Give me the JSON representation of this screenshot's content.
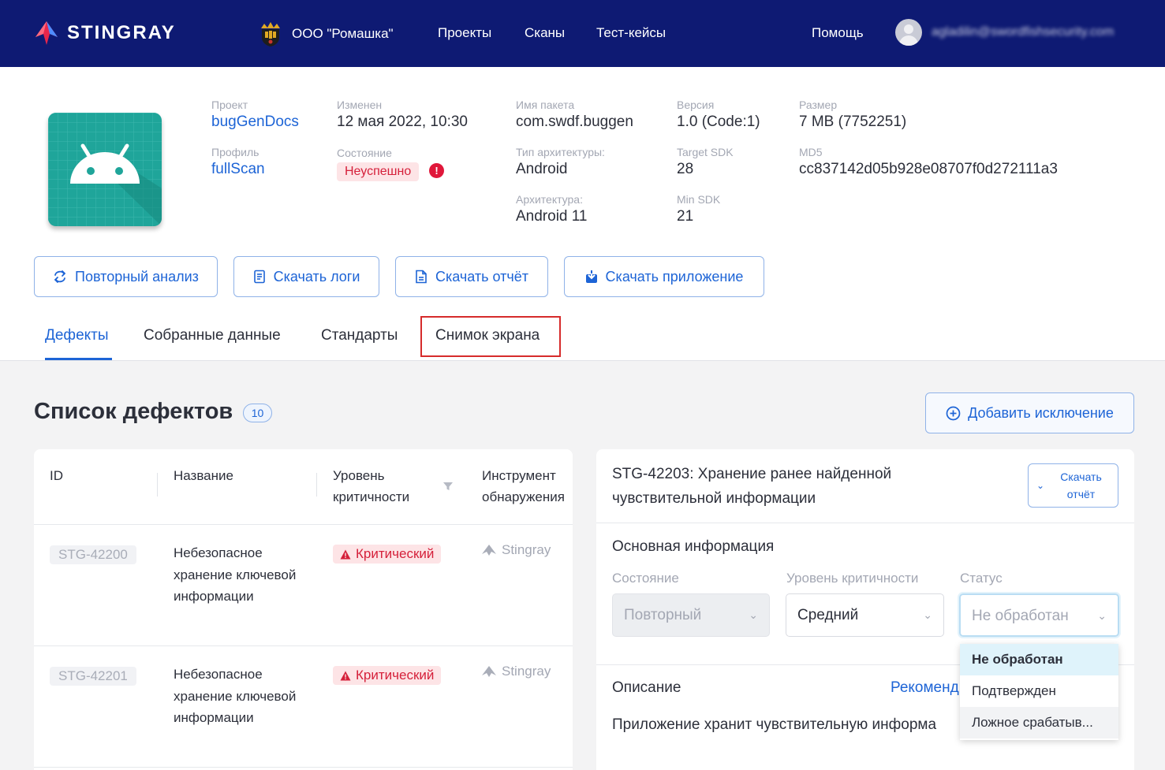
{
  "nav": {
    "brand": "STINGRAY",
    "org": "ООО \"Ромашка\"",
    "links": [
      "Проекты",
      "Сканы",
      "Тест-кейсы"
    ],
    "help": "Помощь",
    "user_email": "agladilin@swordfishsecurity.com"
  },
  "app": {
    "project_label": "Проект",
    "project": "bugGenDocs",
    "profile_label": "Профиль",
    "profile": "fullScan",
    "changed_label": "Изменен",
    "changed": "12 мая 2022, 10:30",
    "state_label": "Состояние",
    "state": "Неуспешно",
    "state_alert": "!",
    "package_label": "Имя пакета",
    "package": "com.swdf.buggen",
    "arch_type_label": "Тип архитектуры:",
    "arch_type": "Android",
    "arch_label": "Архитектура:",
    "arch": "Android 11",
    "version_label": "Версия",
    "version": "1.0 (Code:1)",
    "target_sdk_label": "Target SDK",
    "target_sdk": "28",
    "min_sdk_label": "Min SDK",
    "min_sdk": "21",
    "size_label": "Размер",
    "size": "7 MB (7752251)",
    "md5_label": "MD5",
    "md5": "cc837142d05b928e08707f0d272111a3"
  },
  "actions": {
    "reanalyze": "Повторный анализ",
    "download_logs": "Скачать логи",
    "download_report": "Скачать отчёт",
    "download_app": "Скачать приложение"
  },
  "tabs": [
    "Дефекты",
    "Собранные данные",
    "Стандарты",
    "Снимок экрана"
  ],
  "defects": {
    "title": "Список дефектов",
    "count": "10",
    "add_exception": "Добавить исключение",
    "columns": {
      "id": "ID",
      "name": "Название",
      "severity": "Уровень критичности",
      "tool": "Инструмент обнаружения"
    },
    "rows": [
      {
        "id": "STG-42200",
        "name": "Небезопасное хранение ключевой информации",
        "severity": "Критический",
        "tool": "Stingray"
      },
      {
        "id": "STG-42201",
        "name": "Небезопасное хранение ключевой информации",
        "severity": "Критический",
        "tool": "Stingray"
      }
    ]
  },
  "detail": {
    "title": "STG-42203: Хранение ранее найденной чувствительной информации",
    "download_report": "Скачать отчёт",
    "main_info": "Основная информация",
    "state_label": "Состояние",
    "state_value": "Повторный",
    "severity_label": "Уровень критичности",
    "severity_value": "Средний",
    "status_label": "Статус",
    "status_value": "Не обработан",
    "description_label": "Описание",
    "recommendations": "Рекоменд",
    "description_text": "Приложение хранит чувствительную информа"
  },
  "status_dropdown": {
    "options": [
      "Не обработан",
      "Подтвержден",
      "Ложное срабатыв..."
    ]
  },
  "colors": {
    "nav_bg": "#0e1a73",
    "accent": "#1d64d6",
    "critical": "#d5203a",
    "highlight_box": "#d62b2b",
    "android_green": "#1fa59a"
  }
}
